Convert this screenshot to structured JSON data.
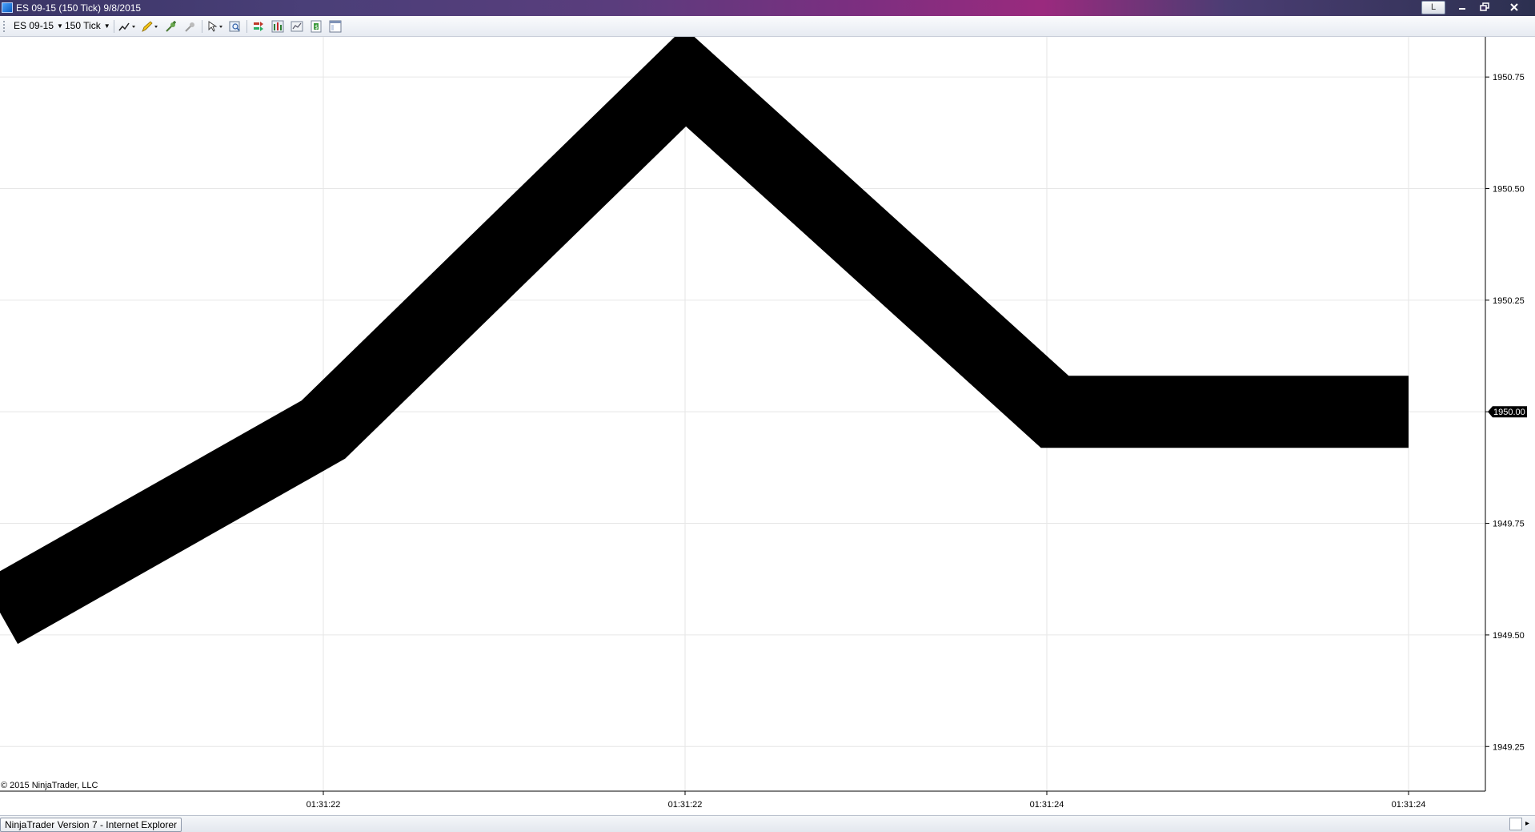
{
  "window": {
    "title": "ES 09-15 (150 Tick)  9/8/2015",
    "layout_button": "L",
    "minimize_icon": "minimize-icon",
    "maximize_icon": "restore-icon",
    "close_icon": "close-icon"
  },
  "toolbar": {
    "instrument": "ES 09-15",
    "interval": "150 Tick",
    "icons": [
      "line-chart-style-icon",
      "drawing-tool-pencil-icon",
      "add-indicator-icon",
      "strategy-icon",
      "cursor-pointer-icon",
      "zoom-icon",
      "trade-arrow-icon",
      "chart-trader-icon",
      "data-series-icon",
      "indicators-icon",
      "properties-icon"
    ]
  },
  "chart_data": {
    "type": "line",
    "x": [
      "01:31:22",
      "01:31:22",
      "01:31:24",
      "01:31:24"
    ],
    "points": [
      {
        "x": "start",
        "y": 1949.55
      },
      {
        "x": "01:31:22",
        "y": 1949.96
      },
      {
        "x": "01:31:22",
        "y": 1950.75
      },
      {
        "x": "01:31:24",
        "y": 1950.0
      },
      {
        "x": "01:31:24",
        "y": 1950.0
      }
    ],
    "ylim": [
      1949.15,
      1950.84
    ],
    "y_ticks": [
      "1950.75",
      "1950.50",
      "1950.25",
      "1950.00",
      "1949.75",
      "1949.50",
      "1949.25"
    ],
    "x_ticks": [
      "01:31:22",
      "01:31:22",
      "01:31:24",
      "01:31:24"
    ],
    "current_price": "1950.00",
    "grid": true,
    "line_color": "#000000",
    "copyright": "© 2015 NinjaTrader, LLC"
  },
  "statusbar": {
    "text": "NinjaTrader Version 7 - Internet Explorer",
    "scroll_icon": "scroll-right-icon"
  }
}
